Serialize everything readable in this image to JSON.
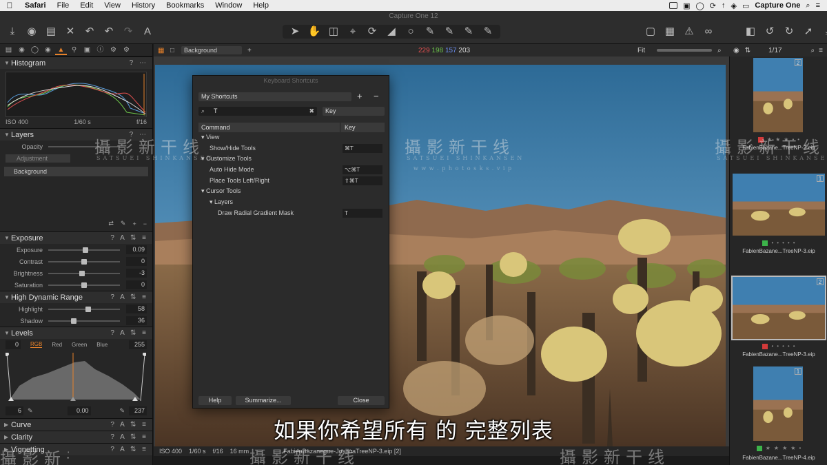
{
  "menubar": {
    "app": "Safari",
    "items": [
      "File",
      "Edit",
      "View",
      "History",
      "Bookmarks",
      "Window",
      "Help"
    ],
    "right_app": "Capture One"
  },
  "window": {
    "title": "Capture One 12"
  },
  "viewer_toolbar": {
    "style_select": "Background",
    "rgb": {
      "r": "229",
      "g": "198",
      "b": "157",
      "l": "203"
    },
    "zoom": "Fit"
  },
  "left_panel": {
    "histogram": {
      "title": "Histogram",
      "iso": "ISO 400",
      "shutter": "1/60 s",
      "aperture": "f/16"
    },
    "layers": {
      "title": "Layers",
      "opacity_label": "Opacity",
      "adjustment_label": "Adjustment",
      "background_layer": "Background"
    },
    "exposure": {
      "title": "Exposure",
      "sliders": [
        {
          "label": "Exposure",
          "value": "0.09",
          "pos": 0.52
        },
        {
          "label": "Contrast",
          "value": "0",
          "pos": 0.5
        },
        {
          "label": "Brightness",
          "value": "-3",
          "pos": 0.47
        },
        {
          "label": "Saturation",
          "value": "0",
          "pos": 0.5
        }
      ]
    },
    "hdr": {
      "title": "High Dynamic Range",
      "sliders": [
        {
          "label": "Highlight",
          "value": "58",
          "pos": 0.56
        },
        {
          "label": "Shadow",
          "value": "36",
          "pos": 0.36
        }
      ]
    },
    "levels": {
      "title": "Levels",
      "left_value": "0",
      "channels": [
        "RGB",
        "Red",
        "Green",
        "Blue"
      ],
      "right_value": "255",
      "bottom": {
        "low": "6",
        "mid": "0.00",
        "high": "237"
      }
    },
    "collapsed": [
      "Curve",
      "Clarity",
      "Vignetting"
    ]
  },
  "dialog": {
    "title": "Keyboard Shortcuts",
    "preset": "My Shortcuts",
    "search_value": "T",
    "search_scope": "Key",
    "columns": {
      "command": "Command",
      "key": "Key"
    },
    "rows": [
      {
        "indent": 0,
        "disclosure": "▾",
        "text": "View",
        "key": ""
      },
      {
        "indent": 1,
        "disclosure": "",
        "text": "Show/Hide Tools",
        "key": "⌘T"
      },
      {
        "indent": 0,
        "disclosure": "▾",
        "text": "Customize Tools",
        "key": ""
      },
      {
        "indent": 1,
        "disclosure": "",
        "text": "Auto Hide Mode",
        "key": "⌥⌘T"
      },
      {
        "indent": 1,
        "disclosure": "",
        "text": "Place Tools Left/Right",
        "key": "⇧⌘T"
      },
      {
        "indent": 0,
        "disclosure": "▾",
        "text": "Cursor Tools",
        "key": ""
      },
      {
        "indent": 1,
        "disclosure": "▾",
        "text": "Layers",
        "key": ""
      },
      {
        "indent": 2,
        "disclosure": "",
        "text": "Draw Radial Gradient Mask",
        "key": "T"
      }
    ],
    "buttons": {
      "help": "Help",
      "summarize": "Summarize...",
      "close": "Close"
    }
  },
  "filmstrip": {
    "counter": "1/17",
    "items": [
      {
        "name": "FabienBazane...TreeNP-2.eip",
        "badge": "2",
        "tag": "#d23a3a",
        "stars": 3
      },
      {
        "name": "FabienBazane...TreeNP-3.eip",
        "badge": "1",
        "tag": "#3cb34a",
        "stars": 0
      },
      {
        "name": "FabienBazane...TreeNP-3.eip",
        "badge": "2",
        "tag": "#d23a3a",
        "stars": 0
      },
      {
        "name": "FabienBazane...TreeNP-4.eip",
        "badge": "1",
        "tag": "#3cb34a",
        "stars": 4
      }
    ]
  },
  "statusbar": {
    "iso": "ISO 400",
    "shutter": "1/60 s",
    "aperture": "f/16",
    "focal": "16 mm",
    "file": "FabienBazanegue-JoshuaTreeNP-3.eip [2]"
  },
  "watermark": {
    "main": "攝影新干线",
    "sub": "SATSUEI SHINKANSEN",
    "url": "w w w . p h o t o s k s . v i p"
  },
  "subtitle": "如果你希望所有 的 完整列表"
}
